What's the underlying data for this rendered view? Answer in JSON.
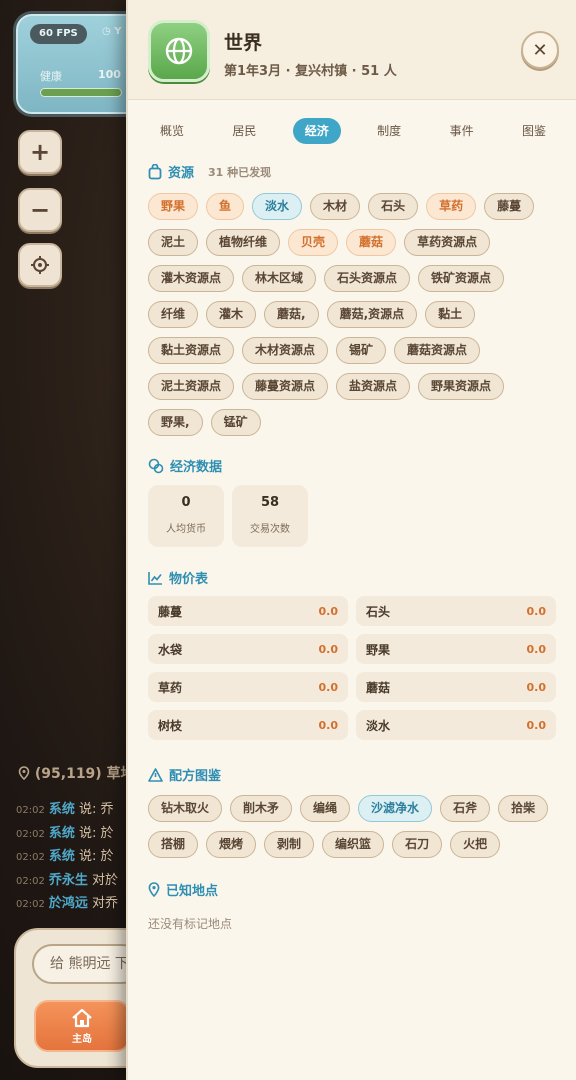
{
  "hud": {
    "fps": "60 FPS",
    "clock": "Y",
    "health_label": "健康",
    "health_value": "100"
  },
  "map_controls": {
    "zoom_in": "+",
    "zoom_out": "−"
  },
  "location_line": "(95,119) 草地",
  "chat": [
    {
      "time": "02:02",
      "name": "系统",
      "text": "说: 乔"
    },
    {
      "time": "02:02",
      "name": "系统",
      "text": "说: 於"
    },
    {
      "time": "02:02",
      "name": "系统",
      "text": "说: 於"
    },
    {
      "time": "02:02",
      "name": "乔永生",
      "text": "对於"
    },
    {
      "time": "02:02",
      "name": "於鸿远",
      "text": "对乔"
    }
  ],
  "chat_input_placeholder": "给 熊明远 下",
  "home_button_label": "主岛",
  "drawer": {
    "title": "世界",
    "subtitle": "第1年3月 · 复兴村镇 · 51 人",
    "tabs": [
      "概览",
      "居民",
      "经济",
      "制度",
      "事件",
      "图鉴"
    ],
    "active_tab": "经济",
    "resources": {
      "title": "资源",
      "meta": "31 种已发现",
      "items": [
        {
          "label": "野果",
          "style": "warm"
        },
        {
          "label": "鱼",
          "style": "warm"
        },
        {
          "label": "淡水",
          "style": "cool"
        },
        {
          "label": "木材",
          "style": "plain"
        },
        {
          "label": "石头",
          "style": "plain"
        },
        {
          "label": "草药",
          "style": "warm"
        },
        {
          "label": "藤蔓",
          "style": "plain"
        },
        {
          "label": "泥土",
          "style": "plain"
        },
        {
          "label": "植物纤维",
          "style": "plain"
        },
        {
          "label": "贝壳",
          "style": "warm"
        },
        {
          "label": "蘑菇",
          "style": "warm"
        },
        {
          "label": "草药资源点",
          "style": "plain"
        },
        {
          "label": "灌木资源点",
          "style": "plain"
        },
        {
          "label": "林木区域",
          "style": "plain"
        },
        {
          "label": "石头资源点",
          "style": "plain"
        },
        {
          "label": "铁矿资源点",
          "style": "plain"
        },
        {
          "label": "纤维",
          "style": "plain"
        },
        {
          "label": "灌木",
          "style": "plain"
        },
        {
          "label": "蘑菇,",
          "style": "plain"
        },
        {
          "label": "蘑菇,资源点",
          "style": "plain"
        },
        {
          "label": "黏土",
          "style": "plain"
        },
        {
          "label": "黏土资源点",
          "style": "plain"
        },
        {
          "label": "木材资源点",
          "style": "plain"
        },
        {
          "label": "锡矿",
          "style": "plain"
        },
        {
          "label": "蘑菇资源点",
          "style": "plain"
        },
        {
          "label": "泥土资源点",
          "style": "plain"
        },
        {
          "label": "藤蔓资源点",
          "style": "plain"
        },
        {
          "label": "盐资源点",
          "style": "plain"
        },
        {
          "label": "野果资源点",
          "style": "plain"
        },
        {
          "label": "野果,",
          "style": "plain"
        },
        {
          "label": "锰矿",
          "style": "plain"
        }
      ]
    },
    "economy": {
      "title": "经济数据",
      "stats": [
        {
          "value": "0",
          "label": "人均货币"
        },
        {
          "value": "58",
          "label": "交易次数"
        }
      ]
    },
    "prices": {
      "title": "物价表",
      "rows": [
        {
          "name": "藤蔓",
          "price": "0.0"
        },
        {
          "name": "石头",
          "price": "0.0"
        },
        {
          "name": "水袋",
          "price": "0.0"
        },
        {
          "name": "野果",
          "price": "0.0"
        },
        {
          "name": "草药",
          "price": "0.0"
        },
        {
          "name": "蘑菇",
          "price": "0.0"
        },
        {
          "name": "树枝",
          "price": "0.0"
        },
        {
          "name": "淡水",
          "price": "0.0"
        }
      ]
    },
    "recipes": {
      "title": "配方图鉴",
      "items": [
        {
          "label": "钻木取火",
          "style": "plain"
        },
        {
          "label": "削木矛",
          "style": "plain"
        },
        {
          "label": "编绳",
          "style": "plain"
        },
        {
          "label": "沙滤净水",
          "style": "cool"
        },
        {
          "label": "石斧",
          "style": "plain"
        },
        {
          "label": "拾柴",
          "style": "plain"
        },
        {
          "label": "搭棚",
          "style": "plain"
        },
        {
          "label": "煨烤",
          "style": "plain"
        },
        {
          "label": "剥制",
          "style": "plain"
        },
        {
          "label": "编织篮",
          "style": "plain"
        },
        {
          "label": "石刀",
          "style": "plain"
        },
        {
          "label": "火把",
          "style": "plain"
        }
      ]
    },
    "places": {
      "title": "已知地点",
      "empty_text": "还没有标记地点"
    }
  },
  "colors": {
    "accent": "#3fa6c8",
    "warm_text": "#d3702d",
    "panel_bg": "#fbf6ec"
  }
}
